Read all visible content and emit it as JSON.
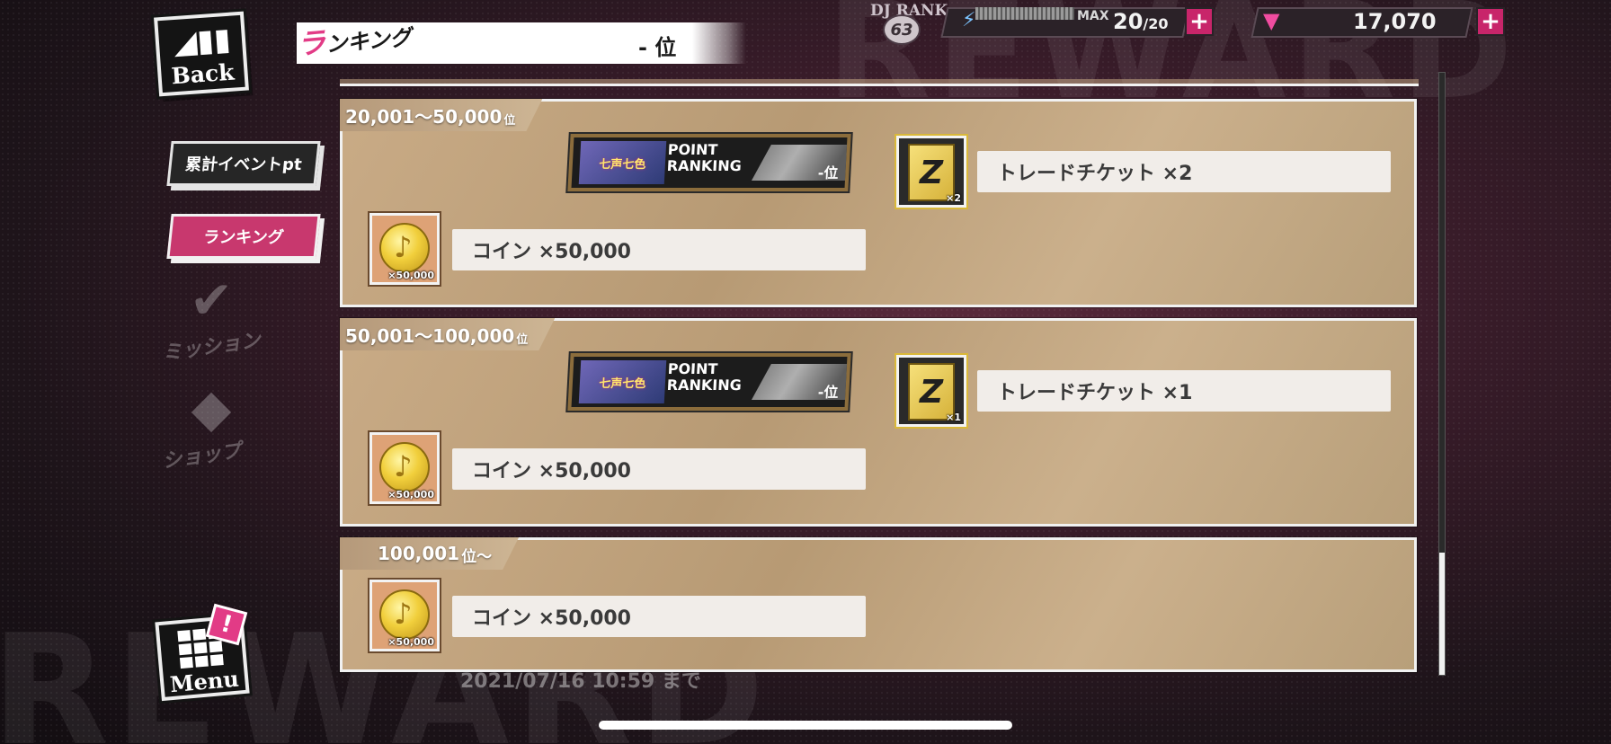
{
  "background_words": {
    "top": "REWARD",
    "bottom": "REWARD"
  },
  "status_bar": {
    "djrank_label": "DJ RANK",
    "djrank_value": "63",
    "energy_max_label": "MAX",
    "energy_value": "20",
    "energy_cap": "/20",
    "gem_value": "17,070",
    "plus": "+",
    "energy_fraction": 1.0
  },
  "back_button": {
    "label": "Back"
  },
  "title_bar": {
    "title_accent": "ラ",
    "title_rest": "ンキング",
    "rank": "- 位"
  },
  "side_menu": {
    "event_pt": "累計イベントpt",
    "ranking": "ランキング",
    "mission": "ミッション",
    "shop": "ショップ"
  },
  "menu_button": {
    "label": "Menu",
    "alert": "!"
  },
  "badge": {
    "logo_text": "七声七色",
    "line1": "POINT",
    "line2": "RANKING",
    "rank": "-位"
  },
  "tiers": [
    {
      "range": "20,001～50,000",
      "suffix": "位",
      "ticket_label": "トレードチケット ×2",
      "ticket_qty": "×2",
      "coin_label": "コイン ×50,000",
      "coin_qty": "×50,000"
    },
    {
      "range": "50,001～100,000",
      "suffix": "位",
      "ticket_label": "トレードチケット ×1",
      "ticket_qty": "×1",
      "coin_label": "コイン ×50,000",
      "coin_qty": "×50,000"
    },
    {
      "range": "100,001",
      "suffix": "位～",
      "coin_label": "コイン ×50,000",
      "coin_qty": "×50,000"
    }
  ],
  "background_date": "2021/07/16 10:59 まで",
  "colors": {
    "accent_pink": "#e23b86",
    "card_tan": "#c9ab86",
    "label_bg": "#f1ede9"
  },
  "icons": [
    "back-arrow-icon",
    "energy-bolt-icon",
    "gem-icon",
    "plus-icon",
    "mission-check-icon",
    "shop-bag-icon",
    "menu-grid-icon",
    "coin-icon",
    "trade-ticket-icon"
  ]
}
